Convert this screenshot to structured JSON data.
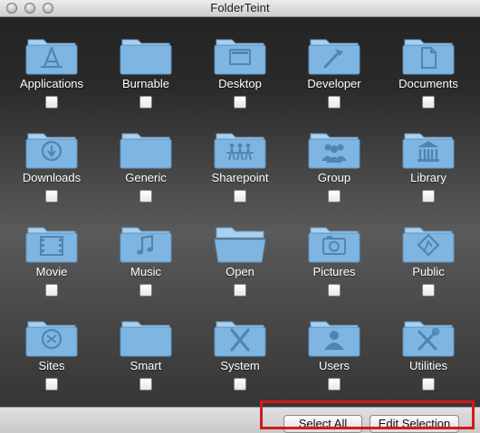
{
  "window": {
    "title": "FolderTeint"
  },
  "colors": {
    "folder_front": "#7fb6e1",
    "folder_back": "#a9d0ef",
    "folder_glyph": "#4f84b4",
    "highlight_box": "#d21a1a"
  },
  "folders": [
    {
      "label": "Applications",
      "icon": "applications-icon",
      "checked": false
    },
    {
      "label": "Burnable",
      "icon": "burnable-icon",
      "checked": false
    },
    {
      "label": "Desktop",
      "icon": "desktop-icon",
      "checked": false
    },
    {
      "label": "Developer",
      "icon": "developer-icon",
      "checked": false
    },
    {
      "label": "Documents",
      "icon": "documents-icon",
      "checked": false
    },
    {
      "label": "Downloads",
      "icon": "downloads-icon",
      "checked": false
    },
    {
      "label": "Generic",
      "icon": "generic-icon",
      "checked": false
    },
    {
      "label": "Sharepoint",
      "icon": "sharepoint-icon",
      "checked": false
    },
    {
      "label": "Group",
      "icon": "group-icon",
      "checked": false
    },
    {
      "label": "Library",
      "icon": "library-icon",
      "checked": false
    },
    {
      "label": "Movie",
      "icon": "movie-icon",
      "checked": false
    },
    {
      "label": "Music",
      "icon": "music-icon",
      "checked": false
    },
    {
      "label": "Open",
      "icon": "open-icon",
      "checked": false
    },
    {
      "label": "Pictures",
      "icon": "pictures-icon",
      "checked": false
    },
    {
      "label": "Public",
      "icon": "public-icon",
      "checked": false
    },
    {
      "label": "Sites",
      "icon": "sites-icon",
      "checked": false
    },
    {
      "label": "Smart",
      "icon": "smart-icon",
      "checked": false
    },
    {
      "label": "System",
      "icon": "system-icon",
      "checked": false
    },
    {
      "label": "Users",
      "icon": "users-icon",
      "checked": false
    },
    {
      "label": "Utilities",
      "icon": "utilities-icon",
      "checked": false
    }
  ],
  "buttons": {
    "select_all": "Select All",
    "edit_selection": "Edit Selection"
  }
}
